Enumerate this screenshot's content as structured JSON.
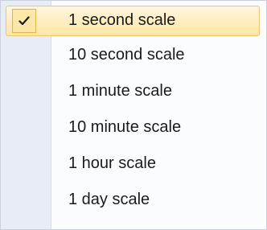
{
  "menu": {
    "items": [
      {
        "label": "1 second scale",
        "checked": true
      },
      {
        "label": "10 second scale",
        "checked": false
      },
      {
        "label": "1 minute scale",
        "checked": false
      },
      {
        "label": "10 minute scale",
        "checked": false
      },
      {
        "label": "1 hour scale",
        "checked": false
      },
      {
        "label": "1 day scale",
        "checked": false
      }
    ],
    "check_icon": "checkmark-icon"
  },
  "colors": {
    "highlight_border": "#e9c77a",
    "highlight_fill": "#ffe6a5",
    "check_box_fill": "#fde7a6",
    "check_box_border": "#e2b24f",
    "gutter": "#e8edf4",
    "menu_background": "#fbfcfe"
  }
}
